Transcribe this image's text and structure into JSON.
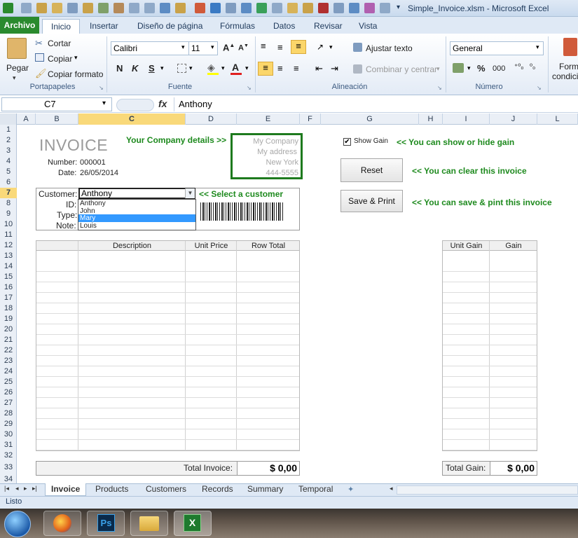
{
  "window": {
    "title": "Simple_Invoice.xlsm  -  Microsoft Excel"
  },
  "ribbon": {
    "tabs": [
      "Archivo",
      "Inicio",
      "Insertar",
      "Diseño de página",
      "Fórmulas",
      "Datos",
      "Revisar",
      "Vista"
    ],
    "clipboard": {
      "paste": "Pegar",
      "cut": "Cortar",
      "copy": "Copiar",
      "format_painter": "Copiar formato",
      "group": "Portapapeles"
    },
    "font": {
      "name": "Calibri",
      "size": "11",
      "bold": "N",
      "italic": "K",
      "underline": "S",
      "group": "Fuente"
    },
    "alignment": {
      "wrap": "Ajustar texto",
      "merge": "Combinar y centrar",
      "group": "Alineación"
    },
    "number": {
      "format": "General",
      "percent": "%",
      "thousands": "000",
      "group": "Número"
    },
    "styles": {
      "cond_format_1": "Form",
      "cond_format_2": "condici"
    }
  },
  "formula_bar": {
    "name_box": "C7",
    "fx": "fx",
    "content": "Anthony"
  },
  "columns": [
    "A",
    "B",
    "C",
    "D",
    "E",
    "F",
    "G",
    "H",
    "I",
    "J",
    "L"
  ],
  "rows": [
    "1",
    "2",
    "3",
    "4",
    "5",
    "6",
    "7",
    "8",
    "9",
    "10",
    "11",
    "12",
    "13",
    "14",
    "15",
    "16",
    "17",
    "18",
    "19",
    "20",
    "21",
    "22",
    "23",
    "24",
    "25",
    "26",
    "27",
    "28",
    "29",
    "30",
    "31",
    "32",
    "33",
    "34"
  ],
  "invoice": {
    "heading": "INVOICE",
    "number_label": "Number:",
    "number_value": "000001",
    "date_label": "Date:",
    "date_value": "26/05/2014",
    "company_note": "Your Company details >>",
    "company": [
      "My Company",
      "My address",
      "New York",
      "444-5555"
    ],
    "customer_label": "Customer:",
    "customer_value": "Anthony",
    "id_label": "ID:",
    "type_label": "Type:",
    "note_label": "Note:",
    "select_note": "<< Select a customer",
    "dropdown_options": [
      "Anthony",
      "John",
      "Mary",
      "Louis"
    ],
    "dropdown_selected": "Mary",
    "table_headers": [
      "Description",
      "Unit Price",
      "Row Total"
    ],
    "gain_headers": [
      "Unit Gain",
      "Gain"
    ],
    "total_label": "Total Invoice:",
    "total_value": "$ 0,00",
    "gain_total_label": "Total Gain:",
    "gain_total_value": "$ 0,00"
  },
  "controls": {
    "show_gain_label": "Show Gain",
    "show_gain_checked": true,
    "show_gain_note": "<< You can show or hide gain",
    "reset_label": "Reset",
    "reset_note": "<< You can clear this invoice",
    "save_label": "Save & Print",
    "save_note": "<< You can save & pint this invoice"
  },
  "sheets": [
    "Invoice",
    "Products",
    "Customers",
    "Records",
    "Summary",
    "Temporal"
  ],
  "active_sheet": "Invoice",
  "status": {
    "text": "Listo"
  },
  "colors": {
    "accent_green": "#1e8a1e",
    "selection_blue": "#3399ff",
    "archivo_green": "#2a8a2e"
  }
}
